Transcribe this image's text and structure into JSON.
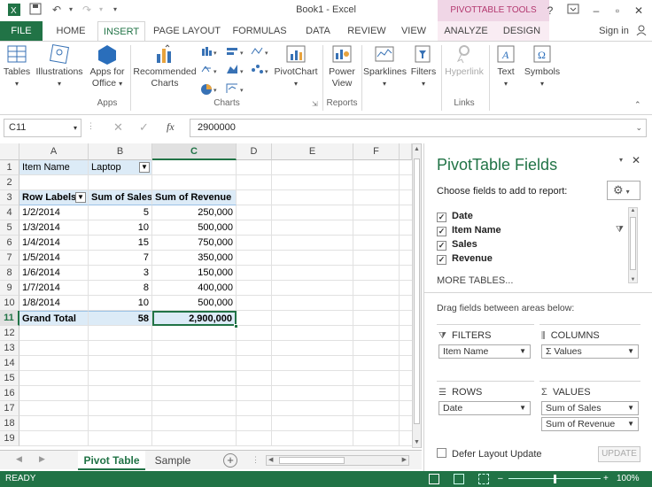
{
  "window": {
    "title": "Book1 - Excel",
    "context_header": "PIVOTTABLE TOOLS",
    "signin": "Sign in"
  },
  "tabs": [
    "FILE",
    "HOME",
    "INSERT",
    "PAGE LAYOUT",
    "FORMULAS",
    "DATA",
    "REVIEW",
    "VIEW",
    "ANALYZE",
    "DESIGN"
  ],
  "ribbon": {
    "tables": "Tables",
    "illustrations": "Illustrations",
    "apps_for_office_1": "Apps for",
    "apps_for_office_2": "Office",
    "recommended_charts_1": "Recommended",
    "recommended_charts_2": "Charts",
    "pivotchart": "PivotChart",
    "power_view_1": "Power",
    "power_view_2": "View",
    "sparklines": "Sparklines",
    "filters": "Filters",
    "hyperlink": "Hyperlink",
    "text": "Text",
    "symbols": "Symbols",
    "group_apps": "Apps",
    "group_charts": "Charts",
    "group_reports": "Reports",
    "group_links": "Links"
  },
  "formula_bar": {
    "name_box": "C11",
    "formula": "2900000",
    "fx": "fx"
  },
  "grid": {
    "columns": [
      "A",
      "B",
      "C",
      "D",
      "E",
      "F"
    ],
    "rows": [
      "1",
      "2",
      "3",
      "4",
      "5",
      "6",
      "7",
      "8",
      "9",
      "10",
      "11",
      "12",
      "13",
      "14",
      "15",
      "16",
      "17",
      "18",
      "19"
    ],
    "r1": {
      "a": "Item Name",
      "b": "Laptop"
    },
    "r3": {
      "a": "Row Labels",
      "b": "Sum of Sales",
      "c": "Sum of Revenue"
    },
    "data": [
      {
        "label": "1/2/2014",
        "sales": "5",
        "revenue": "250,000"
      },
      {
        "label": "1/3/2014",
        "sales": "10",
        "revenue": "500,000"
      },
      {
        "label": "1/4/2014",
        "sales": "15",
        "revenue": "750,000"
      },
      {
        "label": "1/5/2014",
        "sales": "7",
        "revenue": "350,000"
      },
      {
        "label": "1/6/2014",
        "sales": "3",
        "revenue": "150,000"
      },
      {
        "label": "1/7/2014",
        "sales": "8",
        "revenue": "400,000"
      },
      {
        "label": "1/8/2014",
        "sales": "10",
        "revenue": "500,000"
      }
    ],
    "total": {
      "label": "Grand Total",
      "sales": "58",
      "revenue": "2,900,000"
    }
  },
  "sheets": [
    "Pivot Table",
    "Sample"
  ],
  "status": {
    "ready": "READY",
    "zoom": "100%"
  },
  "pane": {
    "title": "PivotTable Fields",
    "subtitle": "Choose fields to add to report:",
    "fields": [
      "Date",
      "Item Name",
      "Sales",
      "Revenue"
    ],
    "more_tables": "MORE TABLES...",
    "drag_label": "Drag fields between areas below:",
    "filters_label": "FILTERS",
    "columns_label": "COLUMNS",
    "rows_label": "ROWS",
    "values_label": "VALUES",
    "filters_item": "Item Name",
    "columns_item": "Σ  Values",
    "rows_item": "Date",
    "values_items": [
      "Sum of Sales",
      "Sum of Revenue"
    ],
    "defer": "Defer Layout Update",
    "update": "UPDATE"
  }
}
